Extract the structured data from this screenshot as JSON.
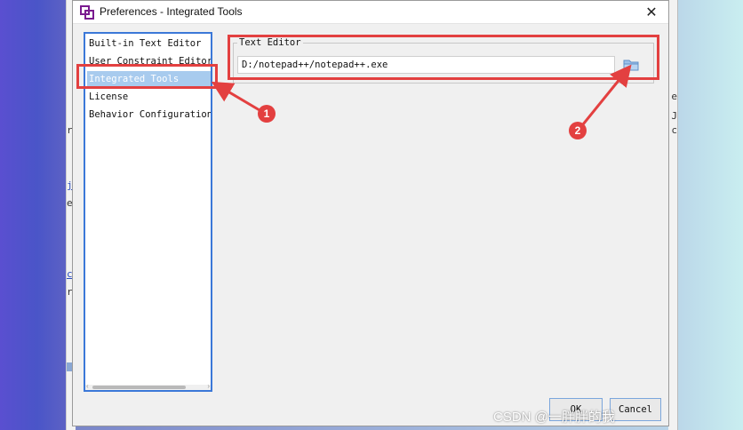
{
  "dialog": {
    "title": "Preferences - Integrated Tools",
    "close_label": "✕"
  },
  "nav": {
    "items": [
      {
        "label": "Built-in Text Editor",
        "selected": false
      },
      {
        "label": "User Constraint Editor",
        "selected": false
      },
      {
        "label": "Integrated Tools",
        "selected": true
      },
      {
        "label": "License",
        "selected": false
      },
      {
        "label": "Behavior Configuration",
        "selected": false
      }
    ]
  },
  "text_editor": {
    "group_label": "Text Editor",
    "path_value": "D:/notepad++/notepad++.exe"
  },
  "buttons": {
    "ok": "OK",
    "cancel": "Cancel"
  },
  "annotations": {
    "badge_1": "1",
    "badge_2": "2"
  },
  "watermark": "CSDN @一胖胖的我",
  "colors": {
    "selection": "#a8cbee",
    "focus_border": "#3b78d8",
    "annotation_red": "#e34040"
  }
}
